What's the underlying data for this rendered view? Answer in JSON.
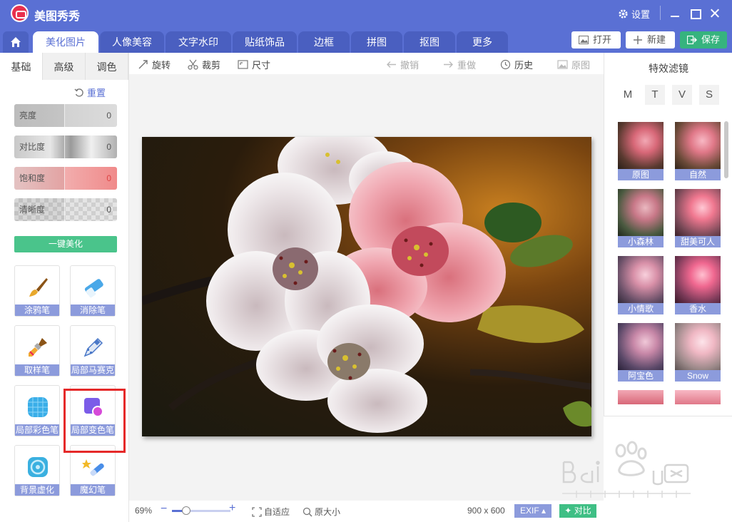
{
  "titlebar": {
    "app_title": "美图秀秀",
    "settings_label": "设置"
  },
  "tabs": [
    {
      "label": "美化图片",
      "active": true
    },
    {
      "label": "人像美容"
    },
    {
      "label": "文字水印"
    },
    {
      "label": "贴纸饰品"
    },
    {
      "label": "边框"
    },
    {
      "label": "拼图"
    },
    {
      "label": "抠图"
    },
    {
      "label": "更多"
    }
  ],
  "actions": {
    "open_label": "打开",
    "new_label": "新建",
    "save_label": "保存"
  },
  "left_panel": {
    "sub_tabs": [
      "基础",
      "高级",
      "调色"
    ],
    "reset_label": "重置",
    "sliders": [
      {
        "label": "亮度",
        "value": "0"
      },
      {
        "label": "对比度",
        "value": "0"
      },
      {
        "label": "饱和度",
        "value": "0"
      },
      {
        "label": "清晰度",
        "value": "0"
      }
    ],
    "one_key_label": "一键美化",
    "tools": [
      {
        "label": "涂鸦笔",
        "icon": "brush-icon"
      },
      {
        "label": "消除笔",
        "icon": "eraser-icon"
      },
      {
        "label": "取样笔",
        "icon": "sample-brush-icon"
      },
      {
        "label": "局部马赛克",
        "icon": "mosaic-pen-icon"
      },
      {
        "label": "局部彩色笔",
        "icon": "color-pen-icon"
      },
      {
        "label": "局部变色笔",
        "icon": "color-change-pen-icon"
      },
      {
        "label": "背景虚化",
        "icon": "background-blur-icon"
      },
      {
        "label": "魔幻笔",
        "icon": "magic-pen-icon"
      }
    ]
  },
  "toolbar": {
    "rotate_label": "旋转",
    "crop_label": "裁剪",
    "size_label": "尺寸",
    "undo_label": "撤销",
    "redo_label": "重做",
    "history_label": "历史",
    "original_label": "原图"
  },
  "right_panel": {
    "title": "特效滤镜",
    "mtvs": [
      "M",
      "T",
      "V",
      "S"
    ],
    "filters": [
      {
        "label": "原图"
      },
      {
        "label": "自然"
      },
      {
        "label": "小森林"
      },
      {
        "label": "甜美可人"
      },
      {
        "label": "小情歌"
      },
      {
        "label": "香水"
      },
      {
        "label": "阿宝色"
      },
      {
        "label": "Snow"
      }
    ]
  },
  "statusbar": {
    "zoom": "69%",
    "zoom_fraction": 0.69,
    "fit_label": "自适应",
    "original_size_label": "原大小",
    "image_size": "900 x 600",
    "exif_label": "EXIF",
    "compare_label": "对比"
  },
  "colors": {
    "brand_blue": "#5a70d4",
    "accent_green": "#36b37e",
    "label_blue": "#8c9bdc",
    "highlight_red": "#e52929"
  }
}
